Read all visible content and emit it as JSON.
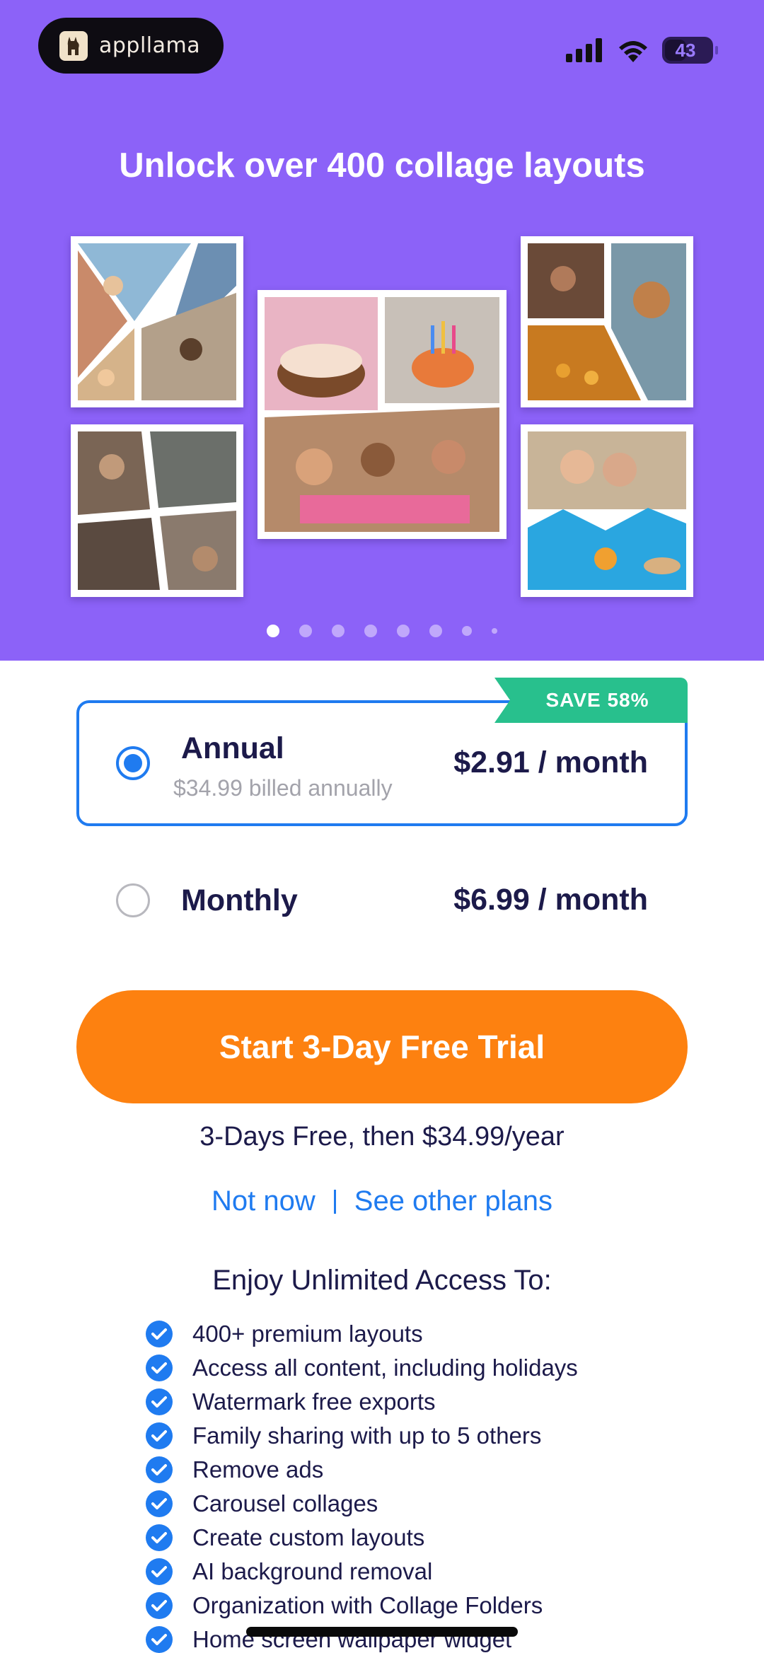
{
  "status_bar": {
    "app_badge": "appllama",
    "battery": "43"
  },
  "hero": {
    "title": "Unlock over 400 collage layouts",
    "carousel_pages": 8,
    "active_page": 1
  },
  "plans": {
    "annual": {
      "badge": "SAVE 58%",
      "name": "Annual",
      "billing": "$34.99 billed annually",
      "price": "$2.91 / month",
      "selected": true
    },
    "monthly": {
      "name": "Monthly",
      "price": "$6.99 / month",
      "selected": false
    }
  },
  "cta": {
    "label": "Start 3-Day Free Trial",
    "note": "3-Days Free, then $34.99/year"
  },
  "links": {
    "not_now": "Not now",
    "other_plans": "See other plans"
  },
  "features": {
    "heading": "Enjoy Unlimited Access To:",
    "items": [
      "400+ premium layouts",
      "Access all content, including holidays",
      "Watermark free exports",
      "Family sharing with up to 5 others",
      "Remove ads",
      "Carousel collages",
      "Create custom layouts",
      "AI background removal",
      "Organization with Collage Folders",
      "Home screen wallpaper widget"
    ]
  },
  "colors": {
    "hero_bg": "#8c62f8",
    "accent_blue": "#1f7bf0",
    "cta_orange": "#fd8110",
    "save_green": "#28c08d",
    "text_navy": "#1c1a4a"
  }
}
